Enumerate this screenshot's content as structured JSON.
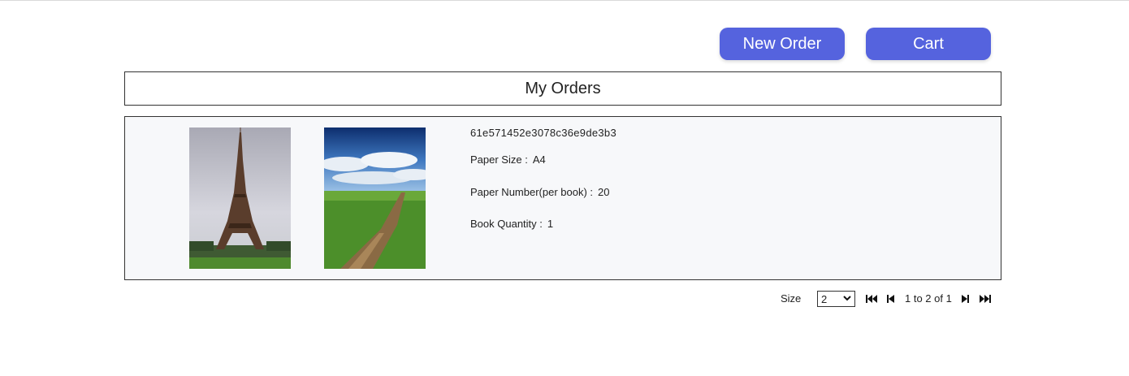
{
  "header": {
    "new_order_label": "New Order",
    "cart_label": "Cart"
  },
  "page_title": "My Orders",
  "order": {
    "id": "61e571452e3078c36e9de3b3",
    "paper_size_label": "Paper Size :",
    "paper_size_value": "A4",
    "paper_number_label": "Paper Number(per book) :",
    "paper_number_value": "20",
    "book_quantity_label": "Book Quantity :",
    "book_quantity_value": "1",
    "images": [
      "eiffel-tower-photo",
      "country-road-photo"
    ]
  },
  "pagination": {
    "size_label": "Size",
    "size_value": "2",
    "range_text": "1 to 2 of 1",
    "icons": [
      "first-page-icon",
      "prev-page-icon",
      "next-page-icon",
      "last-page-icon"
    ]
  },
  "colors": {
    "accent": "#5563de",
    "card_bg": "#f7f8fa"
  }
}
